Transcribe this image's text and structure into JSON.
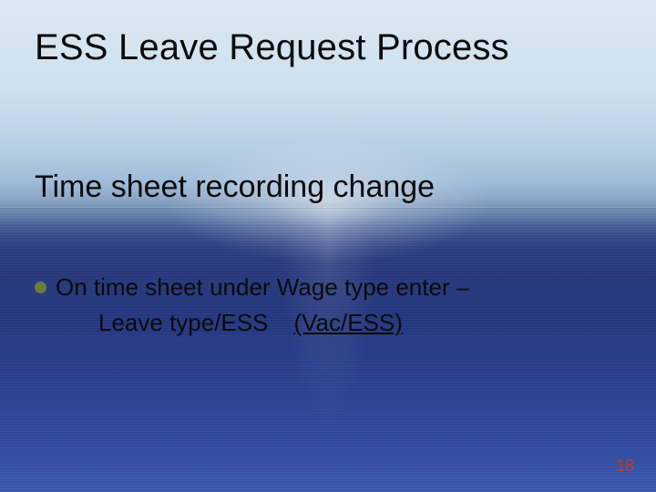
{
  "title": "ESS Leave Request Process",
  "subtitle": "Time sheet recording change",
  "bullet": {
    "line1": "On time sheet under Wage type enter –",
    "line2a": "Leave type/ESS",
    "line2b": "(Vac/ESS)"
  },
  "colors": {
    "bullet_dot": "#6a7d3a",
    "page_number": "#c23a1e"
  },
  "page_number": "18"
}
